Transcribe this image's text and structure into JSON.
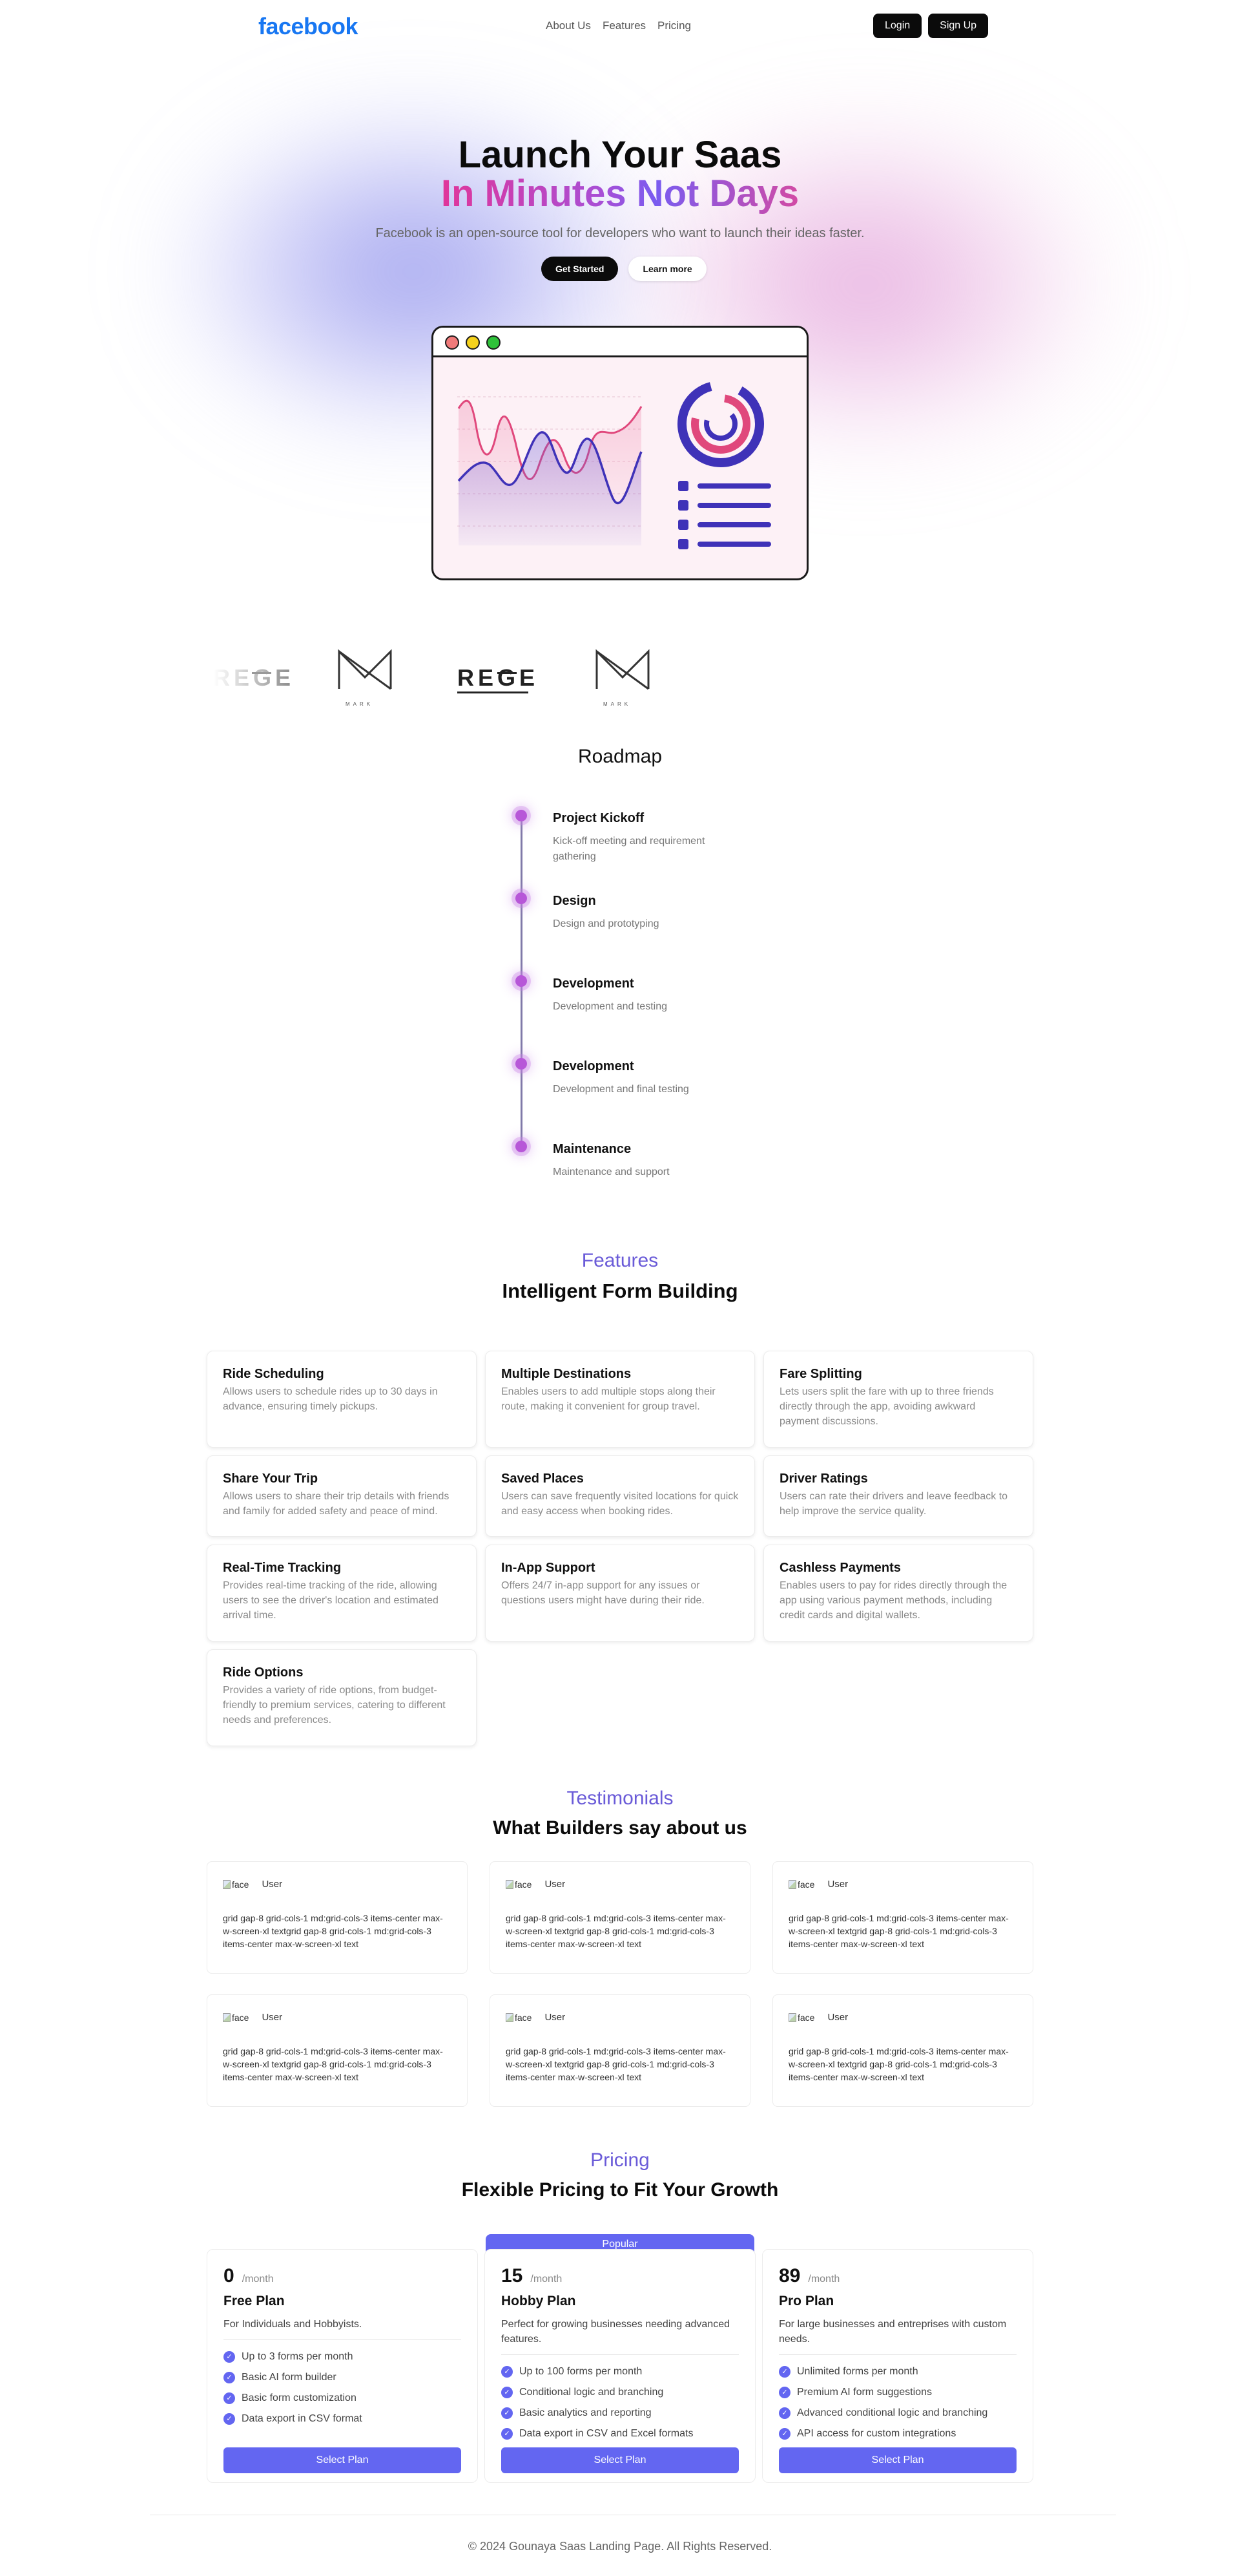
{
  "nav": {
    "logo": "facebook",
    "links": [
      "About Us",
      "Features",
      "Pricing"
    ],
    "login": "Login",
    "signup": "Sign Up"
  },
  "hero": {
    "title_line1": "Launch Your Saas",
    "title_line2": "In Minutes Not Days",
    "subtitle": "Facebook is an open-source tool for developers who want to launch their ideas faster.",
    "cta_primary": "Get Started",
    "cta_secondary": "Learn more"
  },
  "brands": {
    "logo_text": "REGE",
    "logo_mark_caption": "MARK"
  },
  "roadmap": {
    "title": "Roadmap",
    "items": [
      {
        "title": "Project Kickoff",
        "desc": "Kick-off meeting and requirement gathering"
      },
      {
        "title": "Design",
        "desc": "Design and prototyping"
      },
      {
        "title": "Development",
        "desc": "Development and testing"
      },
      {
        "title": "Development",
        "desc": "Development and final testing"
      },
      {
        "title": "Maintenance",
        "desc": "Maintenance and support"
      }
    ]
  },
  "features": {
    "eyebrow": "Features",
    "heading": "Intelligent Form Building",
    "items": [
      {
        "title": "Ride Scheduling",
        "desc": "Allows users to schedule rides up to 30 days in advance, ensuring timely pickups."
      },
      {
        "title": "Multiple Destinations",
        "desc": "Enables users to add multiple stops along their route, making it convenient for group travel."
      },
      {
        "title": "Fare Splitting",
        "desc": "Lets users split the fare with up to three friends directly through the app, avoiding awkward payment discussions."
      },
      {
        "title": "Share Your Trip",
        "desc": "Allows users to share their trip details with friends and family for added safety and peace of mind."
      },
      {
        "title": "Saved Places",
        "desc": "Users can save frequently visited locations for quick and easy access when booking rides."
      },
      {
        "title": "Driver Ratings",
        "desc": "Users can rate their drivers and leave feedback to help improve the service quality."
      },
      {
        "title": "Real-Time Tracking",
        "desc": "Provides real-time tracking of the ride, allowing users to see the driver's location and estimated arrival time."
      },
      {
        "title": "In-App Support",
        "desc": "Offers 24/7 in-app support for any issues or questions users might have during their ride."
      },
      {
        "title": "Cashless Payments",
        "desc": "Enables users to pay for rides directly through the app using various payment methods, including credit cards and digital wallets."
      },
      {
        "title": "Ride Options",
        "desc": "Provides a variety of ride options, from budget-friendly to premium services, catering to different needs and preferences."
      }
    ]
  },
  "testimonials": {
    "eyebrow": "Testimonials",
    "heading": "What Builders say about us",
    "items": [
      {
        "img_alt": "face",
        "name": "User",
        "text": "grid gap-8 grid-cols-1 md:grid-cols-3 items-center max-w-screen-xl textgrid gap-8 grid-cols-1 md:grid-cols-3 items-center max-w-screen-xl text"
      },
      {
        "img_alt": "face",
        "name": "User",
        "text": "grid gap-8 grid-cols-1 md:grid-cols-3 items-center max-w-screen-xl textgrid gap-8 grid-cols-1 md:grid-cols-3 items-center max-w-screen-xl text"
      },
      {
        "img_alt": "face",
        "name": "User",
        "text": "grid gap-8 grid-cols-1 md:grid-cols-3 items-center max-w-screen-xl textgrid gap-8 grid-cols-1 md:grid-cols-3 items-center max-w-screen-xl text"
      },
      {
        "img_alt": "face",
        "name": "User",
        "text": "grid gap-8 grid-cols-1 md:grid-cols-3 items-center max-w-screen-xl textgrid gap-8 grid-cols-1 md:grid-cols-3 items-center max-w-screen-xl text"
      },
      {
        "img_alt": "face",
        "name": "User",
        "text": "grid gap-8 grid-cols-1 md:grid-cols-3 items-center max-w-screen-xl textgrid gap-8 grid-cols-1 md:grid-cols-3 items-center max-w-screen-xl text"
      },
      {
        "img_alt": "face",
        "name": "User",
        "text": "grid gap-8 grid-cols-1 md:grid-cols-3 items-center max-w-screen-xl textgrid gap-8 grid-cols-1 md:grid-cols-3 items-center max-w-screen-xl text"
      }
    ]
  },
  "pricing": {
    "eyebrow": "Pricing",
    "heading": "Flexible Pricing to Fit Your Growth",
    "popular_badge": "Popular",
    "plans": [
      {
        "price": "0",
        "period": "/month",
        "name": "Free Plan",
        "desc": "For Individuals and Hobbyists.",
        "features": [
          "Up to 3 forms per month",
          "Basic AI form builder",
          "Basic form customization",
          "Data export in CSV format"
        ],
        "cta": "Select Plan"
      },
      {
        "price": "15",
        "period": "/month",
        "name": "Hobby Plan",
        "desc": "Perfect for growing businesses needing advanced features.",
        "features": [
          "Up to 100 forms per month",
          "Conditional logic and branching",
          "Basic analytics and reporting",
          "Data export in CSV and Excel formats"
        ],
        "cta": "Select Plan"
      },
      {
        "price": "89",
        "period": "/month",
        "name": "Pro Plan",
        "desc": "For large businesses and entreprises with custom needs.",
        "features": [
          "Unlimited forms per month",
          "Premium AI form suggestions",
          "Advanced conditional logic and branching",
          "API access for custom integrations"
        ],
        "cta": "Select Plan"
      }
    ]
  },
  "footer": {
    "text": "© 2024 Gounaya Saas Landing Page. All Rights Reserved."
  },
  "colors": {
    "accent": "#6366f1",
    "brand": "#1877f2",
    "timeline_dot": "#b757d8"
  }
}
